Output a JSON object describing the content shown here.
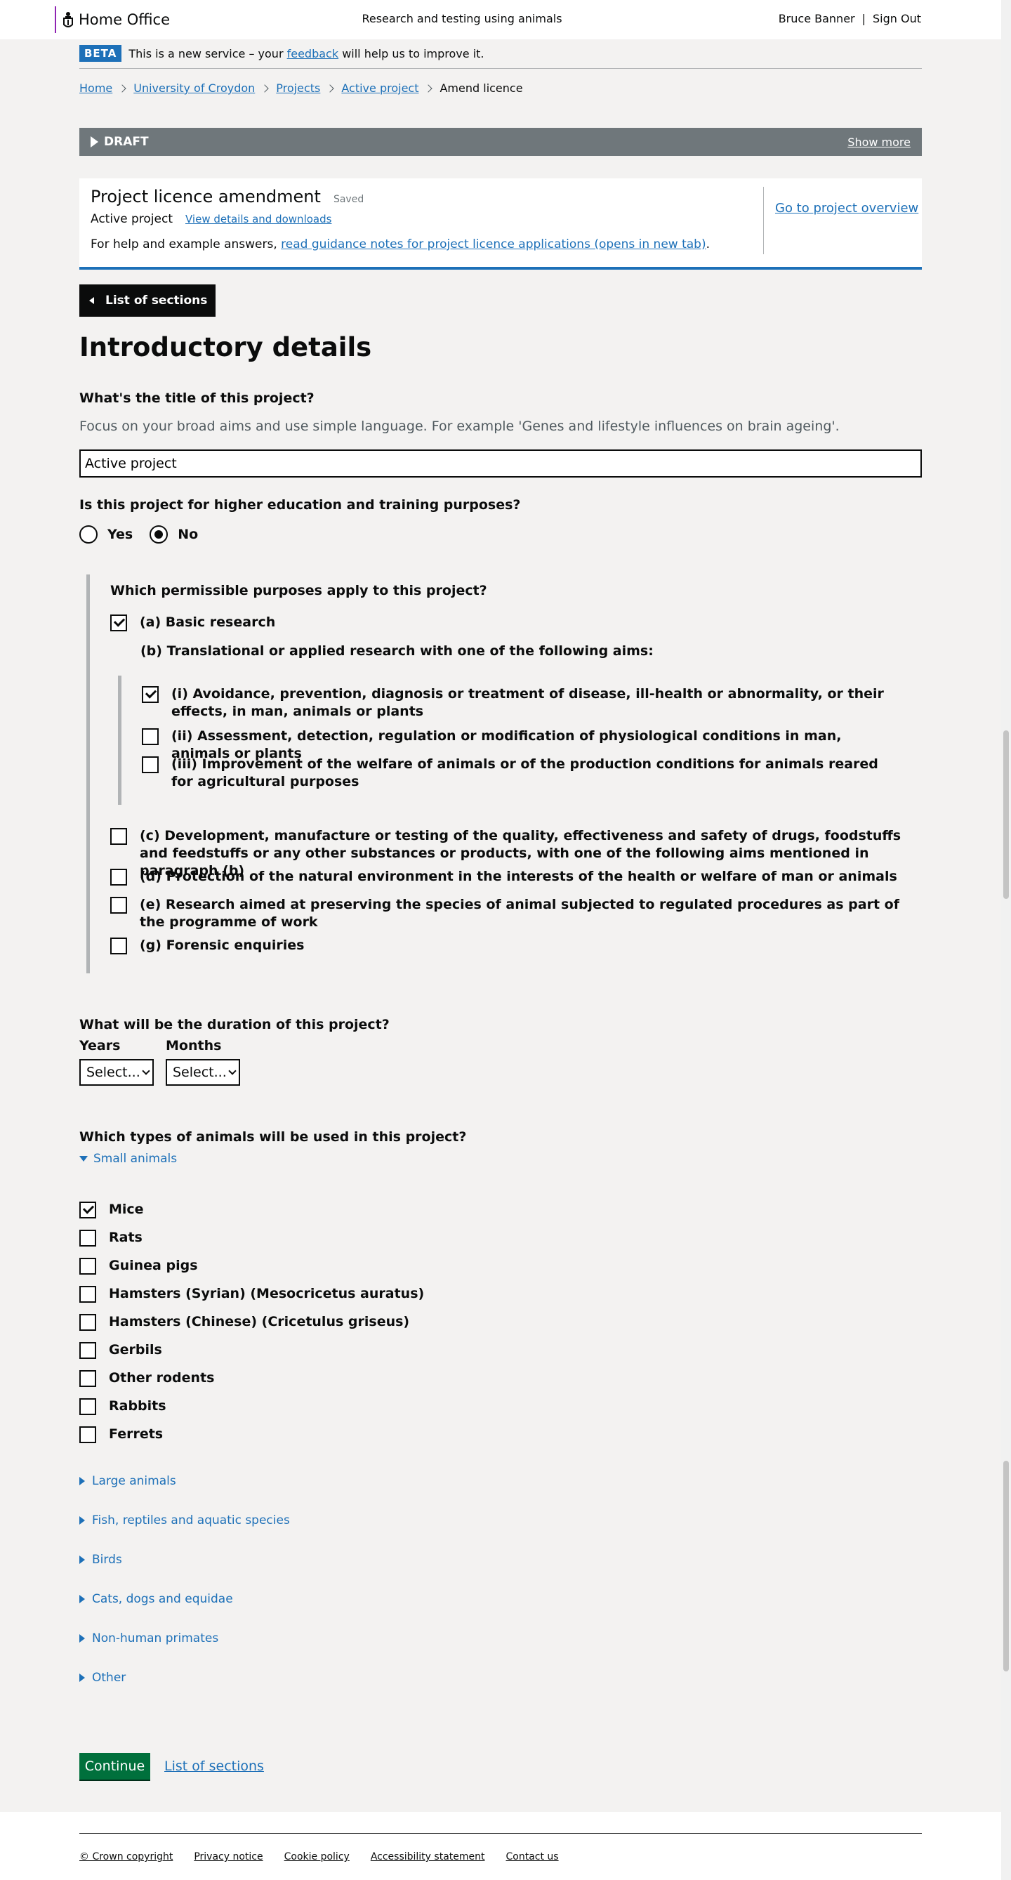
{
  "header": {
    "logo_text": "Home Office",
    "title": "Research and testing using animals",
    "user_name": "Bruce Banner",
    "separator": "|",
    "sign_out": "Sign Out"
  },
  "phase": {
    "tag": "BETA",
    "text_before": "This is a new service – your",
    "link": "feedback",
    "text_after": "will help us to improve it."
  },
  "breadcrumbs": {
    "home": "Home",
    "establishment": "University of Croydon",
    "projects": "Projects",
    "project": "Active project",
    "current": "Amend licence"
  },
  "draft": {
    "label": "DRAFT",
    "show_more": "Show more"
  },
  "amendment": {
    "title": "Project licence amendment",
    "status": "Saved",
    "project_name": "Active project",
    "details_link": "View details and downloads",
    "help_prefix": "For help and example answers,",
    "help_link": "read guidance notes for project licence applications (opens in new tab)",
    "help_suffix": ".",
    "overview_link": "Go to project overview"
  },
  "nav": {
    "sections_button": "List of sections"
  },
  "page": {
    "heading": "Introductory details"
  },
  "title_question": {
    "label": "What's the title of this project?",
    "hint": "Focus on your broad aims and use simple language. For example 'Genes and lifestyle influences on brain ageing'.",
    "value": "Active project"
  },
  "training_question": {
    "label": "Is this project for higher education and training purposes?",
    "options": [
      "Yes",
      "No"
    ],
    "selected": "No"
  },
  "purposes": {
    "label": "Which permissible purposes apply to this project?",
    "a": {
      "label": "(a) Basic research",
      "checked": true
    },
    "b_heading": "(b) Translational or applied research with one of the following aims:",
    "b1": {
      "label": "(i) Avoidance, prevention, diagnosis or treatment of disease, ill-health or abnormality, or their effects, in man, animals or plants",
      "checked": true
    },
    "b2": {
      "label": "(ii) Assessment, detection, regulation or modification of physiological conditions in man, animals or plants",
      "checked": false
    },
    "b3": {
      "label": "(iii) Improvement of the welfare of animals or of the production conditions for animals reared for agricultural purposes",
      "checked": false
    },
    "c": {
      "label": "(c) Development, manufacture or testing of the quality, effectiveness and safety of drugs, foodstuffs and feedstuffs or any other substances or products, with one of the following aims mentioned in paragraph (b)",
      "checked": false
    },
    "d": {
      "label": "(d) Protection of the natural environment in the interests of the health or welfare of man or animals",
      "checked": false
    },
    "e": {
      "label": "(e) Research aimed at preserving the species of animal subjected to regulated procedures as part of the programme of work",
      "checked": false
    },
    "g": {
      "label": "(g) Forensic enquiries",
      "checked": false
    }
  },
  "duration": {
    "label": "What will be the duration of this project?",
    "years_label": "Years",
    "months_label": "Months",
    "years_value": "Select...",
    "months_value": "Select..."
  },
  "animals": {
    "label": "Which types of animals will be used in this project?",
    "small_group": "Small animals",
    "small": [
      {
        "label": "Mice",
        "checked": true
      },
      {
        "label": "Rats",
        "checked": false
      },
      {
        "label": "Guinea pigs",
        "checked": false
      },
      {
        "label": "Hamsters (Syrian) (Mesocricetus auratus)",
        "checked": false
      },
      {
        "label": "Hamsters (Chinese) (Cricetulus griseus)",
        "checked": false
      },
      {
        "label": "Gerbils",
        "checked": false
      },
      {
        "label": "Other rodents",
        "checked": false
      },
      {
        "label": "Rabbits",
        "checked": false
      },
      {
        "label": "Ferrets",
        "checked": false
      }
    ],
    "other_groups": [
      "Large animals",
      "Fish, reptiles and aquatic species",
      "Birds",
      "Cats, dogs and equidae",
      "Non-human primates",
      "Other"
    ]
  },
  "actions": {
    "continue": "Continue",
    "sections_link": "List of sections"
  },
  "footer": {
    "links": [
      "© Crown copyright",
      "Privacy notice",
      "Cookie policy",
      "Accessibility statement",
      "Contact us"
    ]
  },
  "colors": {
    "link": "#1d70b8",
    "beta_tag": "#1d70b8",
    "draft_bar": "#6f777b",
    "continue_button": "#00703c",
    "logo_rule": "#8f23b3"
  }
}
